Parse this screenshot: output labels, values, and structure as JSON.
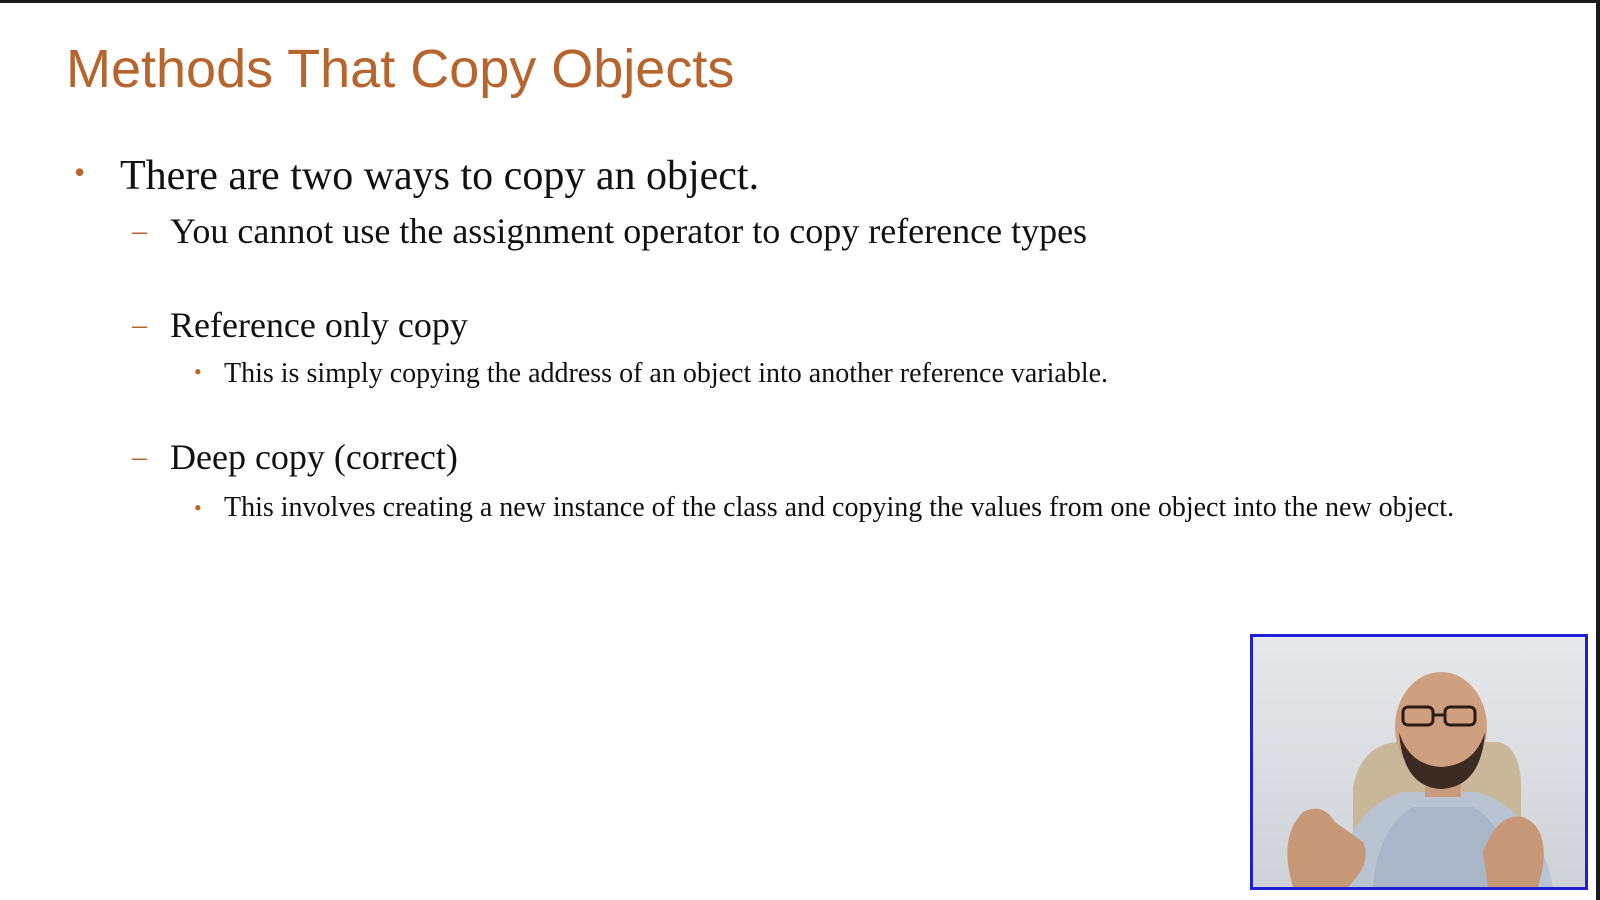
{
  "slide": {
    "title": "Methods That Copy Objects",
    "bullets": {
      "main": "There are two ways to copy an object.",
      "sub1": "You cannot use the assignment operator to copy reference types",
      "sub2": "Reference only copy",
      "sub2_detail": "This is simply copying the address of an object into another reference variable.",
      "sub3": "Deep copy (correct)",
      "sub3_detail": "This involves creating a new instance of the class and copying the values from one object into the new object."
    },
    "markers": {
      "bullet": "•",
      "dash": "–"
    },
    "colors": {
      "title": "#b5652d",
      "text": "#111111",
      "webcam_border": "#1f1fd6"
    }
  },
  "webcam": {
    "icon": "presenter-video-icon"
  }
}
